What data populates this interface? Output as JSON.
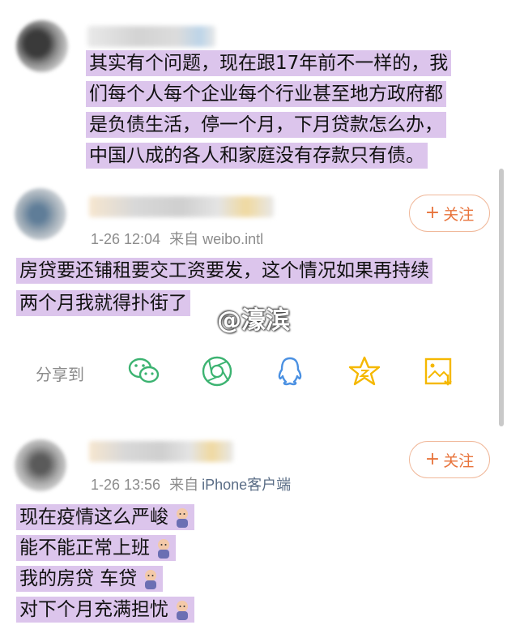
{
  "comment1": {
    "lines": [
      "其实有个问题，现在跟17年前不一样的，我",
      "们每个人每个企业每个行业甚至地方政府都",
      "是负债生活，停一个月，下月贷款怎么办，",
      "中国八成的各人和家庭没有存款只有债。"
    ]
  },
  "comment2": {
    "follow_label": "关注",
    "time": "1-26 12:04",
    "source": "来自 weibo.intl",
    "lines": [
      "房贷要还铺租要交工资要发，这个情况如果再持续",
      "两个月我就得扑街了"
    ]
  },
  "watermark": "@濠滨",
  "share_bar": {
    "label": "分享到",
    "icons": [
      "wechat-icon",
      "moments-icon",
      "qq-icon",
      "qzone-icon",
      "save-image-icon"
    ],
    "colors": {
      "green": "#3cb371",
      "blue": "#4a90e2",
      "yellow": "#f5b800"
    }
  },
  "comment3": {
    "follow_label": "关注",
    "time": "1-26 13:56",
    "source_prefix": "来自",
    "source": "iPhone客户端",
    "lines": [
      "现在疫情这么严峻",
      "能不能正常上班",
      "我的房贷 车贷",
      "对下个月充满担忧"
    ]
  },
  "accent_color": "#e8743c",
  "highlight_color": "#dcc5ec"
}
